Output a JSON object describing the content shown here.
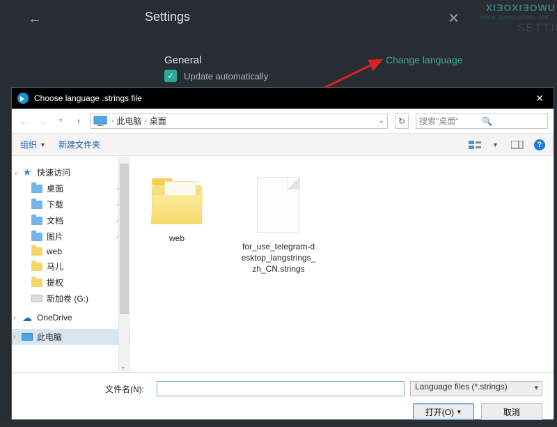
{
  "watermark": {
    "brand": "XIƎOXIƎOWU",
    "sub": "www.xiaoxiaowu.me"
  },
  "setting_side": "SETTING",
  "settings": {
    "title": "Settings",
    "section": "General",
    "change_language": "Change language",
    "update_label": "Update automatically"
  },
  "dialog": {
    "title": "Choose language .strings file",
    "breadcrumb": {
      "root": "此电脑",
      "folder": "桌面"
    },
    "search_placeholder": "搜索\"桌面\"",
    "toolbar": {
      "organize": "组织",
      "new_folder": "新建文件夹"
    },
    "sidebar": {
      "quick": "快速访问",
      "items": [
        "桌面",
        "下载",
        "文档",
        "图片",
        "web",
        "马儿",
        "提权",
        "新加卷 (G:)"
      ],
      "onedrive": "OneDrive",
      "thispc": "此电脑"
    },
    "files": [
      {
        "type": "folder",
        "name": "web"
      },
      {
        "type": "doc",
        "name": "for_use_telegram-desktop_langstrings_zh_CN.strings"
      }
    ],
    "filename_label": "文件名(N):",
    "filter": "Language files (*.strings)",
    "open_btn": "打开(O)",
    "cancel_btn": "取消"
  }
}
